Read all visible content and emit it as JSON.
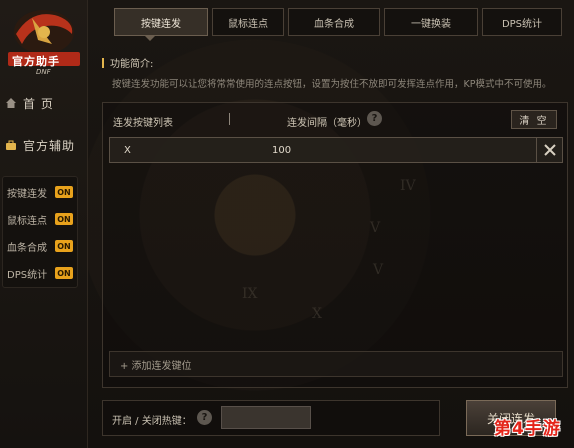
{
  "logo": {
    "text": "官方助手",
    "sub": "DNF"
  },
  "sidebar": {
    "home_label": "首 页",
    "assist_label": "官方辅助",
    "submenu": [
      {
        "label": "按键连发",
        "badge": "ON"
      },
      {
        "label": "鼠标连点",
        "badge": "ON"
      },
      {
        "label": "血条合成",
        "badge": "ON"
      },
      {
        "label": "DPS统计",
        "badge": "ON"
      }
    ]
  },
  "tabs": [
    "按键连发",
    "鼠标连点",
    "血条合成",
    "一键换装",
    "DPS统计"
  ],
  "intro": {
    "title": "功能简介:",
    "desc": "按键连发功能可以让您将常常使用的连点按钮，设置为按住不放即可发挥连点作用，KP模式中不可使用。"
  },
  "list": {
    "col_key": "连发按键列表",
    "col_interval": "连发间隔（毫秒）",
    "help": "?",
    "clear_label": "清 空",
    "rows": [
      {
        "key": "X",
        "interval": "100"
      }
    ],
    "add_label": "+ 添加连发键位"
  },
  "hotkey": {
    "label": "开启 / 关闭热键：",
    "help": "?",
    "value": ""
  },
  "close_label": "关闭连发",
  "watermark": "第4手游",
  "colors": {
    "badge": "#e8a21c",
    "accent": "#e3b54d",
    "watermark": "#e4241a"
  }
}
